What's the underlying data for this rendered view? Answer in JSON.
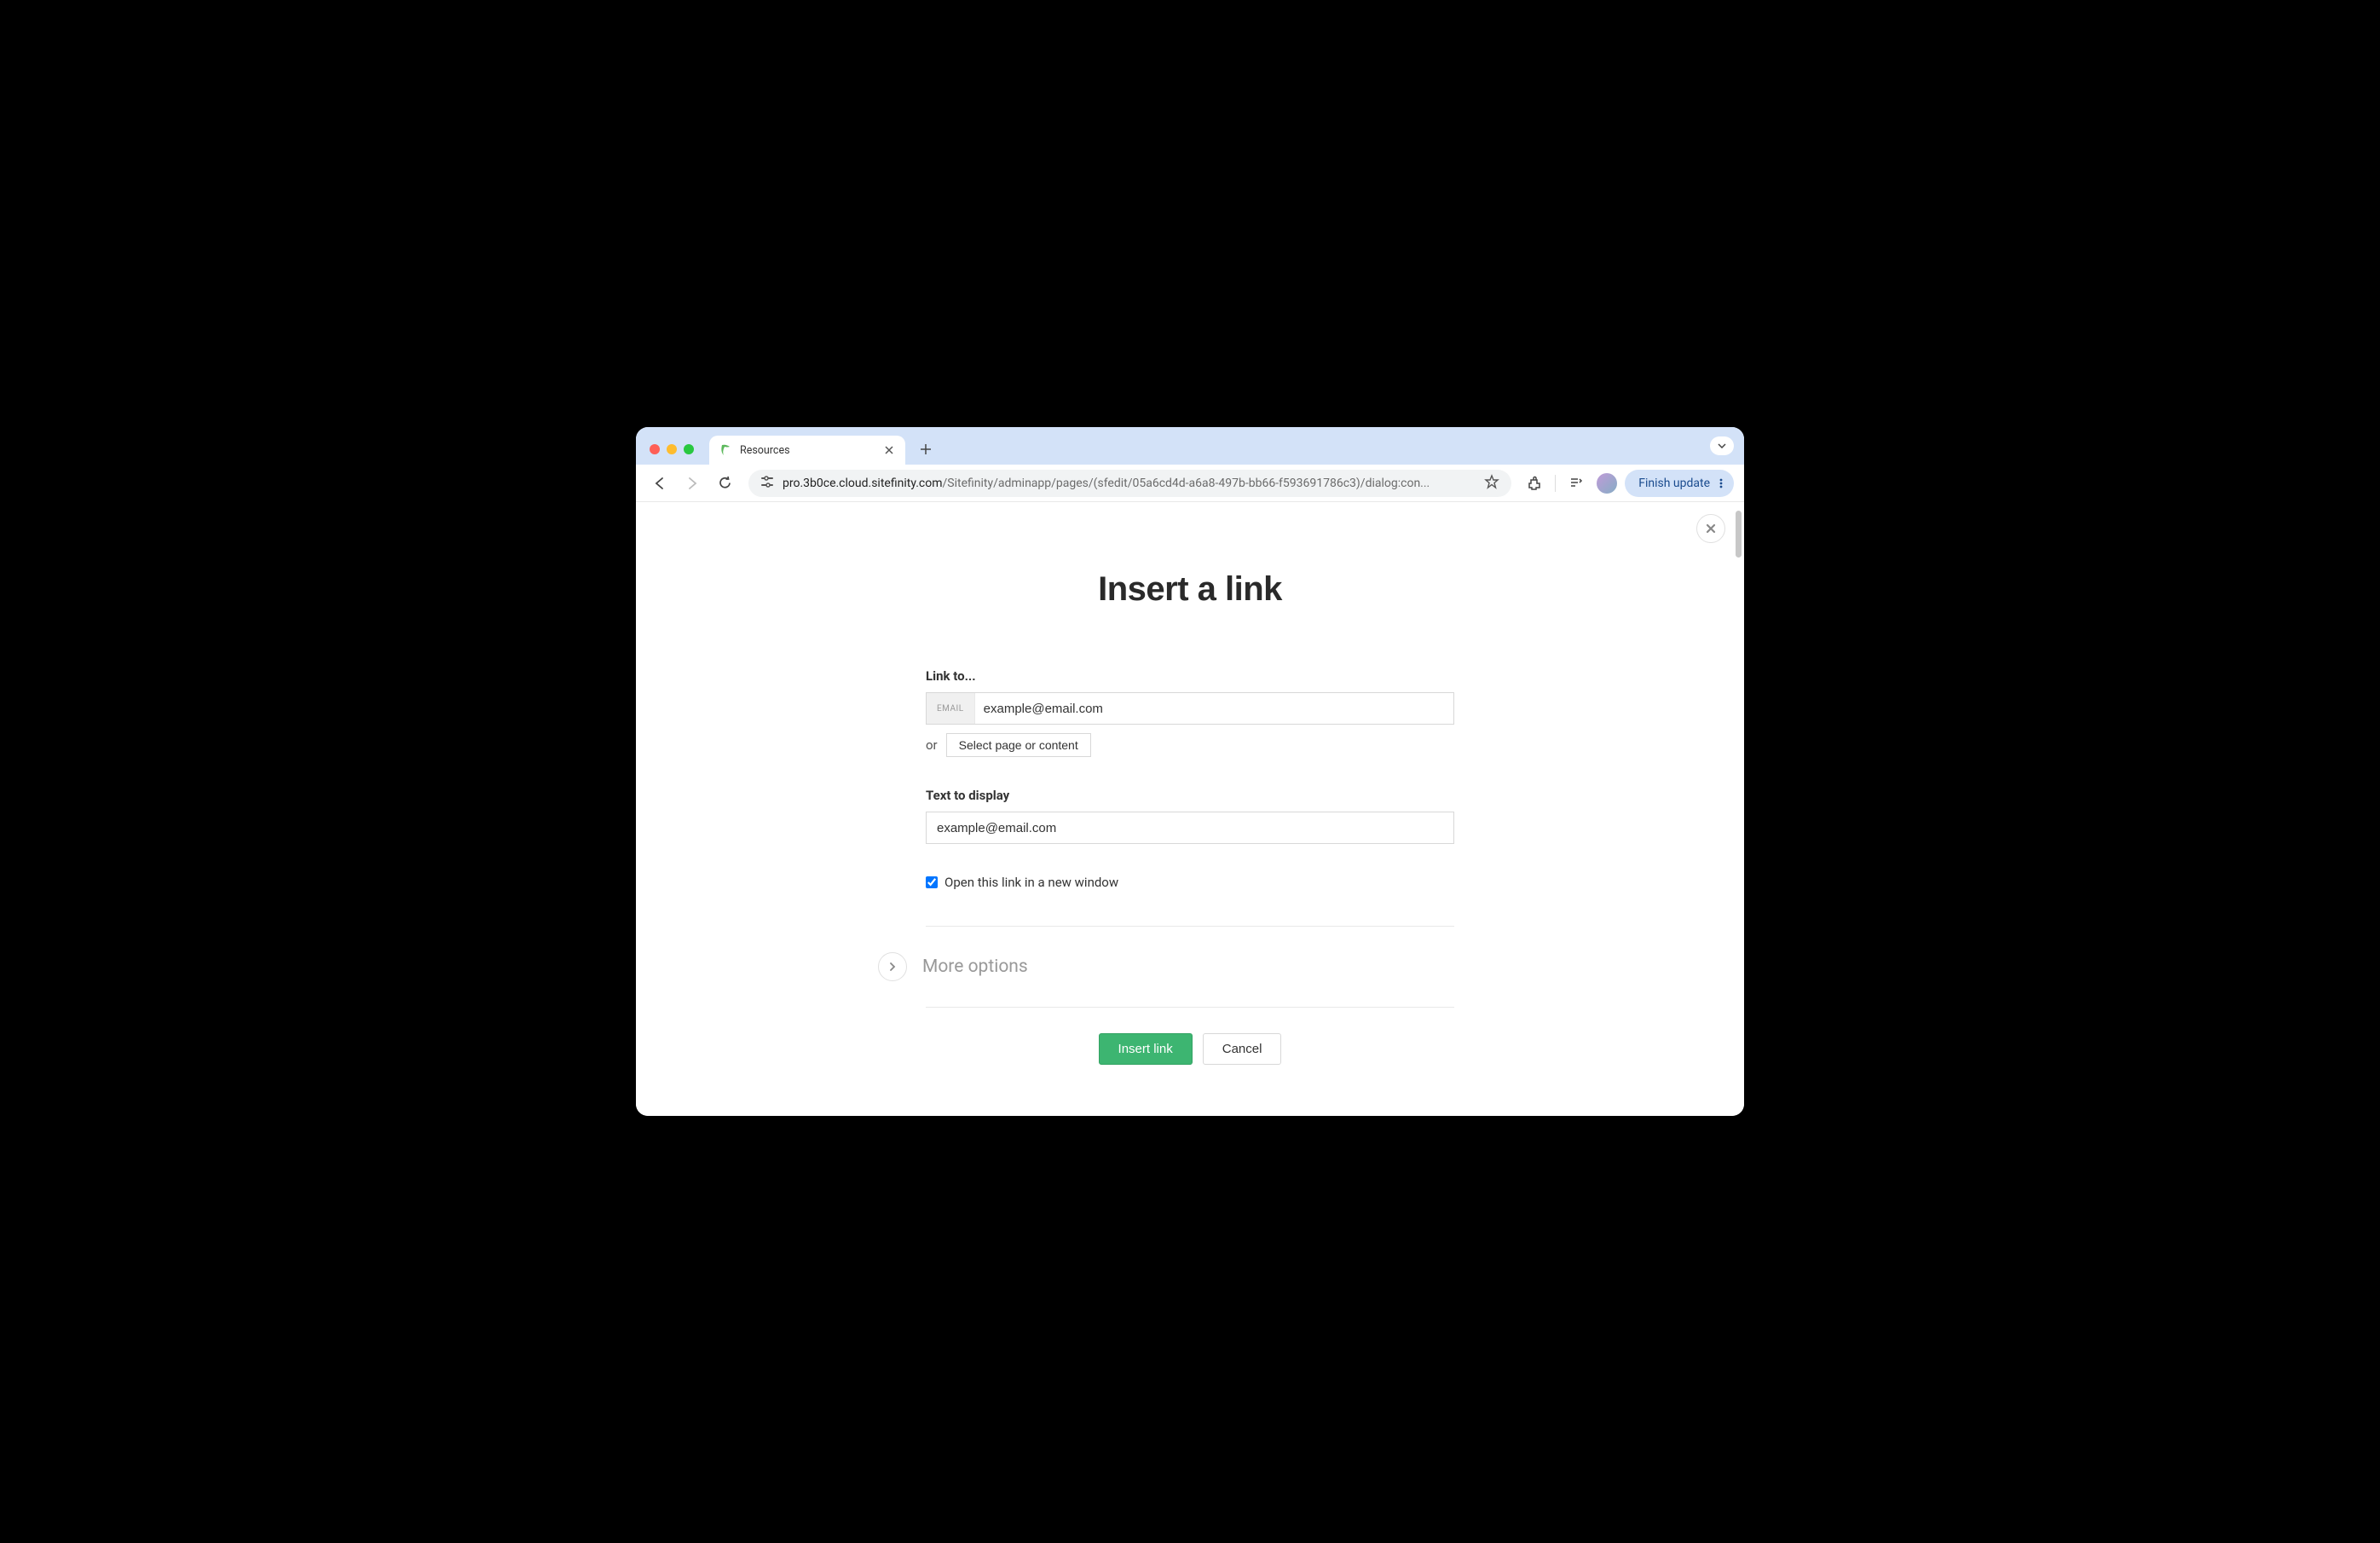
{
  "browser": {
    "tab_title": "Resources",
    "url_host": "pro.3b0ce.cloud.sitefinity.com",
    "url_path": "/Sitefinity/adminapp/pages/(sfedit/05a6cd4d-a6a8-497b-bb66-f593691786c3)/dialog:con...",
    "finish_update": "Finish update"
  },
  "dialog": {
    "heading": "Insert a link",
    "link_to_label": "Link to...",
    "link_prefix": "EMAIL",
    "link_value": "example@email.com",
    "or_text": "or",
    "select_page_label": "Select page or content",
    "text_display_label": "Text to display",
    "text_display_value": "example@email.com",
    "new_window_label": "Open this link in a new window",
    "new_window_checked": true,
    "more_options_label": "More options",
    "insert_button": "Insert link",
    "cancel_button": "Cancel"
  }
}
